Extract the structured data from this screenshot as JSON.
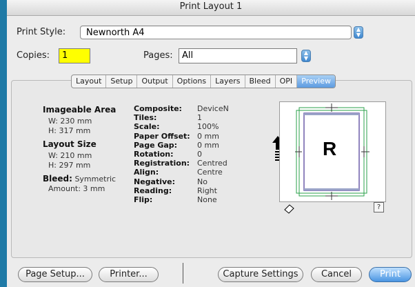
{
  "window": {
    "title": "Print Layout 1"
  },
  "print_style": {
    "label": "Print Style:",
    "value": "Newnorth A4"
  },
  "copies": {
    "label": "Copies:",
    "value": "1"
  },
  "pages": {
    "label": "Pages:",
    "value": "All"
  },
  "tabs": [
    "Layout",
    "Setup",
    "Output",
    "Options",
    "Layers",
    "Bleed",
    "OPI",
    "Preview"
  ],
  "active_tab": "Preview",
  "info": {
    "imageable_area": {
      "title": "Imageable Area",
      "w": "W: 230 mm",
      "h": "H: 317 mm"
    },
    "layout_size": {
      "title": "Layout Size",
      "w": "W: 210 mm",
      "h": "H: 297 mm"
    },
    "bleed": {
      "label": "Bleed:",
      "value": "Symmetric",
      "amount": "Amount: 3 mm"
    }
  },
  "settings": [
    {
      "label": "Composite:",
      "value": "DeviceN"
    },
    {
      "label": "Tiles:",
      "value": "1"
    },
    {
      "label": "Scale:",
      "value": "100%"
    },
    {
      "label": "Paper Offset:",
      "value": "0 mm"
    },
    {
      "label": "Page Gap:",
      "value": "0 mm"
    },
    {
      "label": "Rotation:",
      "value": "0"
    },
    {
      "label": "Registration:",
      "value": "Centred"
    },
    {
      "label": "Align:",
      "value": "Centre"
    },
    {
      "label": "Negative:",
      "value": "No"
    },
    {
      "label": "Reading:",
      "value": "Right"
    },
    {
      "label": "Flip:",
      "value": "None"
    }
  ],
  "preview": {
    "page_letter": "R",
    "help": "?"
  },
  "buttons": {
    "page_setup": "Page Setup...",
    "printer": "Printer...",
    "capture": "Capture Settings",
    "cancel": "Cancel",
    "print": "Print"
  },
  "colors": {
    "copies_highlight": "#ffff00",
    "accent": "#4a95e2",
    "window_bg": "#1f7aa6"
  }
}
